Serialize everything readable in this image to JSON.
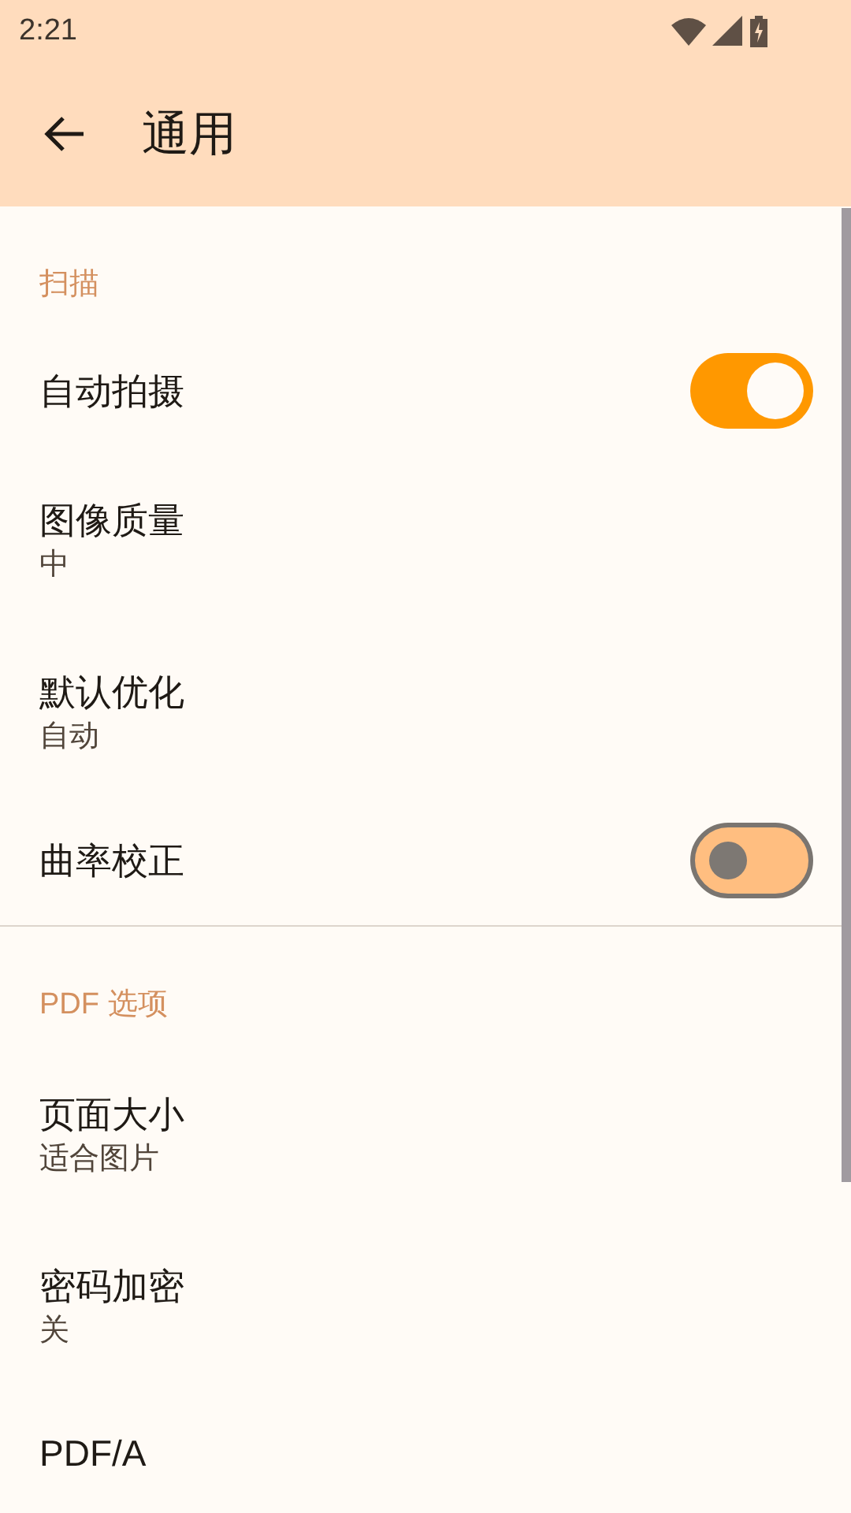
{
  "status_bar": {
    "time": "2:21"
  },
  "app_bar": {
    "title": "通用"
  },
  "sections": [
    {
      "header": "扫描",
      "items": [
        {
          "kind": "switch",
          "title": "自动拍摄",
          "on": true
        },
        {
          "kind": "value",
          "title": "图像质量",
          "value": "中"
        },
        {
          "kind": "value",
          "title": "默认优化",
          "value": "自动"
        },
        {
          "kind": "switch",
          "title": "曲率校正",
          "on": false
        }
      ]
    },
    {
      "header": "PDF 选项",
      "items": [
        {
          "kind": "value",
          "title": "页面大小",
          "value": "适合图片"
        },
        {
          "kind": "value",
          "title": "密码加密",
          "value": "关"
        },
        {
          "kind": "plain",
          "title": "PDF/A"
        }
      ]
    }
  ]
}
